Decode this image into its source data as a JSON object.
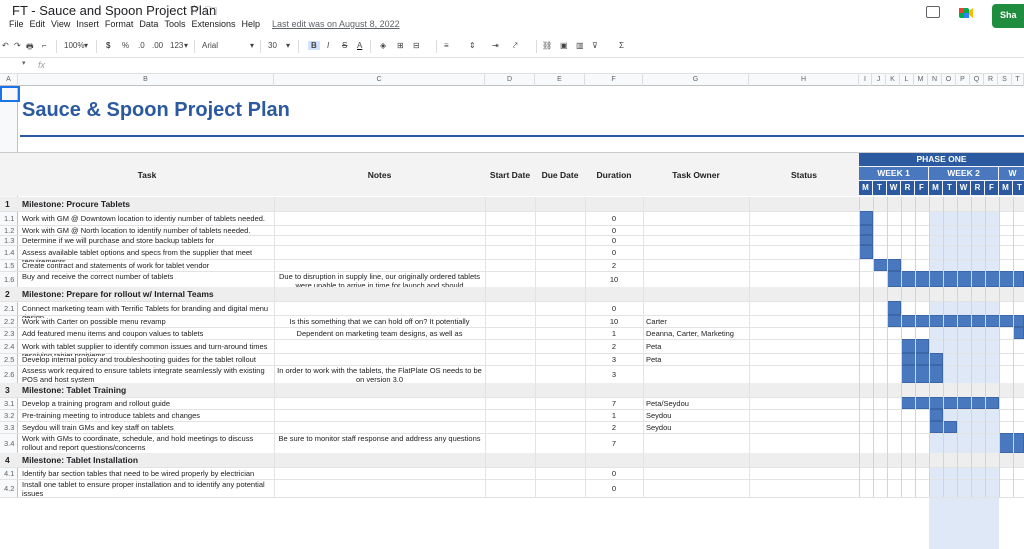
{
  "window": {
    "title": "FT - Sauce and Spoon Project Plan",
    "menu": [
      "File",
      "Edit",
      "View",
      "Insert",
      "Format",
      "Data",
      "Tools",
      "Extensions",
      "Help"
    ],
    "last_edit": "Last edit was on August 8, 2022",
    "share_label": "Sha"
  },
  "toolbar": {
    "zoom": "100%",
    "currency": "$",
    "percent": "%",
    "dec_decrease": ".0",
    "dec_increase": ".00",
    "format_more": "123",
    "font": "Arial",
    "font_size": "30",
    "bold": "B",
    "italic": "I",
    "strike": "S",
    "text_color": "A"
  },
  "formula": {
    "fx": "fx"
  },
  "columns": [
    "A",
    "B",
    "C",
    "D",
    "E",
    "F",
    "G",
    "H",
    "I",
    "J",
    "K",
    "L",
    "M",
    "N",
    "O",
    "P",
    "Q",
    "R",
    "S",
    "T"
  ],
  "sheet": {
    "title": "Sauce & Spoon Project Plan",
    "headers": {
      "task": "Task",
      "notes": "Notes",
      "start": "Start Date",
      "due": "Due Date",
      "duration": "Duration",
      "owner": "Task Owner",
      "status": "Status"
    },
    "phase": "PHASE ONE",
    "weeks": [
      "WEEK 1",
      "WEEK 2",
      "W"
    ],
    "days": [
      "M",
      "T",
      "W",
      "R",
      "F",
      "M",
      "T",
      "W",
      "R",
      "F",
      "M",
      "T"
    ],
    "rows": [
      {
        "type": "milestone",
        "num": "1",
        "label": "Milestone: Procure Tablets"
      },
      {
        "num": "1.1",
        "task": "Work with GM @ Downtown location to identiy number of tablets needed.",
        "notes": "",
        "duration": "0",
        "owner": "",
        "bars": [
          [
            0,
            1
          ]
        ]
      },
      {
        "num": "1.2",
        "task": "Work with GM @ North location to identify number of tablets needed.",
        "notes": "",
        "duration": "0",
        "owner": "",
        "bars": [
          [
            0,
            1
          ]
        ]
      },
      {
        "num": "1.3",
        "task": "Determine if we will purchase and store backup tablets for",
        "notes": "",
        "duration": "0",
        "owner": "",
        "bars": [
          [
            0,
            1
          ]
        ]
      },
      {
        "num": "1.4",
        "task": "Assess available tablet options and specs from the supplier that meet requirements.",
        "notes": "",
        "duration": "0",
        "owner": "",
        "bars": [
          [
            0,
            1
          ]
        ]
      },
      {
        "num": "1.5",
        "task": "Create contract and statements of work for tablet vendor",
        "notes": "",
        "duration": "2",
        "owner": "",
        "bars": [
          [
            1,
            2
          ]
        ]
      },
      {
        "num": "1.6",
        "task": "Buy and receive the correct number of tablets",
        "notes": "Due to disruption in supply line, our originally ordered tablets were unable to arrive in time for launch and should",
        "duration": "10",
        "owner": "",
        "bars": [
          [
            2,
            12
          ]
        ]
      },
      {
        "type": "milestone",
        "num": "2",
        "label": "Milestone: Prepare for rollout w/ Internal Teams"
      },
      {
        "num": "2.1",
        "task": "Connect marketing team with Terrific Tablets for branding and digital menu design",
        "notes": "",
        "duration": "0",
        "owner": "",
        "bars": [
          [
            2,
            1
          ]
        ]
      },
      {
        "num": "2.2",
        "task": "Work with Carter on possible menu revamp",
        "notes": "Is this something that we can hold off on? It potentially",
        "duration": "10",
        "owner": "Carter",
        "bars": [
          [
            2,
            12
          ]
        ]
      },
      {
        "num": "2.3",
        "task": "Add featured menu items and coupon values to tablets",
        "notes": "Dependent on marketing team designs, as well as",
        "duration": "1",
        "owner": "Deanna, Carter, Marketing",
        "bars": [
          [
            11,
            1
          ]
        ]
      },
      {
        "num": "2.4",
        "task": "Work with tablet supplier to identify common issues and turn-around times resolving tablet problems.",
        "notes": "",
        "duration": "2",
        "owner": "Peta",
        "bars": [
          [
            3,
            2
          ]
        ]
      },
      {
        "num": "2.5",
        "task": "Develop internal policy and troubleshooting guides for the tablet rollout",
        "notes": "",
        "duration": "3",
        "owner": "Peta",
        "bars": [
          [
            3,
            3
          ]
        ]
      },
      {
        "num": "2.6",
        "task": "Assess work required to ensure tablets integrate seamlessly with existing POS and host system",
        "notes": "In order to work with the tablets, the FlatPlate OS needs to be on version 3.0",
        "duration": "3",
        "owner": "",
        "bars": [
          [
            3,
            3
          ]
        ]
      },
      {
        "type": "milestone",
        "num": "3",
        "label": "Milestone: Tablet Training"
      },
      {
        "num": "3.1",
        "task": "Develop a training program and rollout guide",
        "notes": "",
        "duration": "7",
        "owner": "Peta/Seydou",
        "bars": [
          [
            3,
            7
          ]
        ]
      },
      {
        "num": "3.2",
        "task": "Pre-training meeting to introduce tablets and changes",
        "notes": "",
        "duration": "1",
        "owner": "Seydou",
        "bars": [
          [
            5,
            1
          ]
        ]
      },
      {
        "num": "3.3",
        "task": "Seydou will train GMs and key staff on tablets",
        "notes": "",
        "duration": "2",
        "owner": "Seydou",
        "bars": [
          [
            5,
            2
          ]
        ]
      },
      {
        "num": "3.4",
        "task": "Work with GMs to coordinate, schedule, and hold meetings to discuss rollout and report questions/concerns",
        "notes": "Be sure to monitor staff response and address any questions",
        "duration": "7",
        "owner": "",
        "bars": [
          [
            10,
            2
          ]
        ]
      },
      {
        "type": "milestone",
        "num": "4",
        "label": "Milestone: Tablet Installation"
      },
      {
        "num": "4.1",
        "task": "Identify bar section tables that need to be wired properly by electrician",
        "notes": "",
        "duration": "0",
        "owner": "",
        "bars": []
      },
      {
        "num": "4.2",
        "task": "Install one tablet to ensure proper installation and to identify any potential issues",
        "notes": "",
        "duration": "0",
        "owner": "",
        "bars": []
      }
    ]
  },
  "colors": {
    "accent": "#2b5aa0",
    "bar": "#4a78bf",
    "week2": "#dfe8f6",
    "share": "#1e8e3e"
  }
}
